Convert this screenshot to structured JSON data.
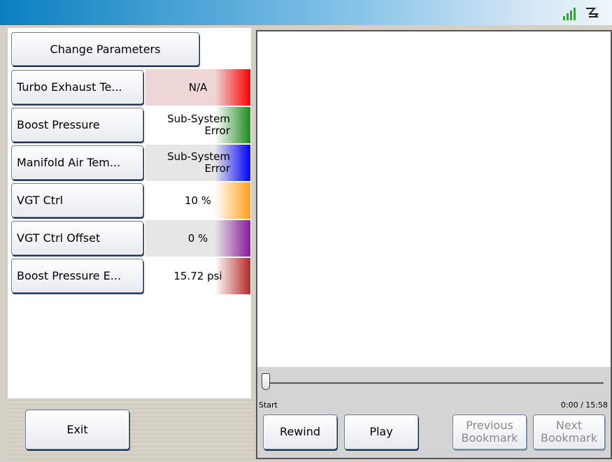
{
  "parameters_button": "Change Parameters",
  "rows": [
    {
      "label": "Turbo Exhaust Te...",
      "value": "N/A",
      "color": "#ff0000",
      "shaded": true
    },
    {
      "label": "Boost Pressure",
      "value": "Sub-System Error",
      "color": "#1f8a1f",
      "shaded": false
    },
    {
      "label": "Manifold Air Tem...",
      "value": "Sub-System Error",
      "color": "#0000ff",
      "shaded": true
    },
    {
      "label": "VGT Ctrl",
      "value": "10 %",
      "color": "#ff9f1a",
      "shaded": false
    },
    {
      "label": "VGT Ctrl Offset",
      "value": "0 %",
      "color": "#8a1a9a",
      "shaded": true
    },
    {
      "label": "Boost Pressure E...",
      "value": "15.72 psi",
      "color": "#b52a2a",
      "shaded": false
    }
  ],
  "exit_label": "Exit",
  "playback": {
    "start_label": "Start",
    "time": "0:00 / 15:58",
    "position": 0,
    "rewind": "Rewind",
    "play": "Play",
    "previous_bookmark": "Previous Bookmark",
    "next_bookmark": "Next Bookmark"
  },
  "status_icons": [
    "signal-icon",
    "plug-icon"
  ],
  "colors": {
    "titlebar_start": "#0a7fc0",
    "shaded_row": "#e6e6e6",
    "first_row_shade": "#eed6d6"
  }
}
